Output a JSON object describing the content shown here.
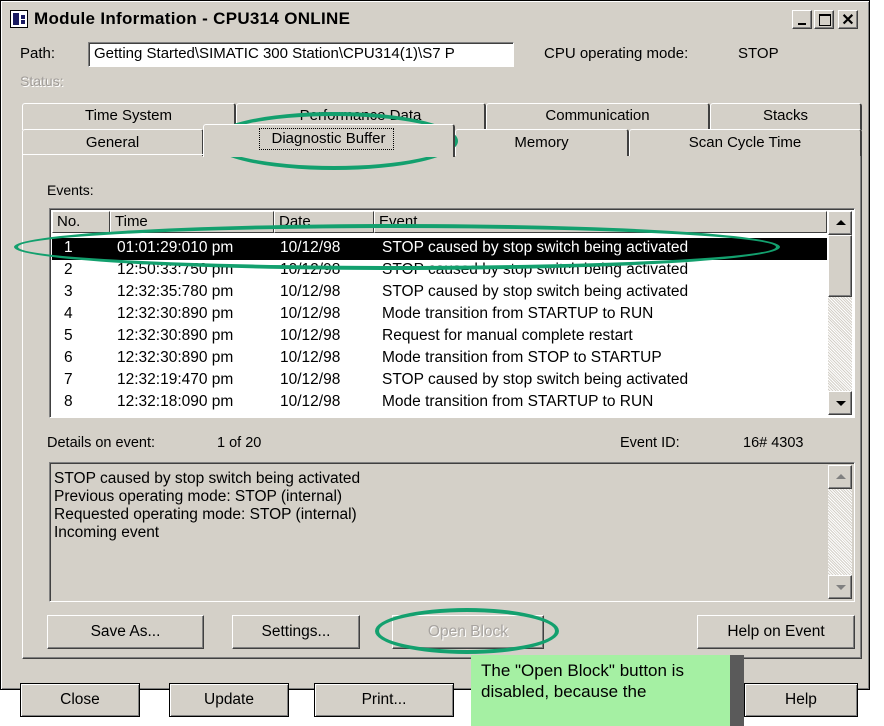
{
  "window": {
    "title": "Module Information - CPU314  ONLINE"
  },
  "path": {
    "label": "Path:",
    "value": "Getting Started\\SIMATIC 300 Station\\CPU314(1)\\S7 P"
  },
  "cpu_mode": {
    "label": "CPU operating mode:",
    "value": "STOP"
  },
  "status": {
    "label": "Status:"
  },
  "tabs_top": [
    "Time System",
    "Performance Data",
    "Communication",
    "Stacks"
  ],
  "tabs_bottom": [
    "General",
    "Diagnostic Buffer",
    "Memory",
    "Scan Cycle Time"
  ],
  "events": {
    "label": "Events:",
    "columns": [
      "No.",
      "Time",
      "Date",
      "Event"
    ],
    "rows": [
      {
        "no": "1",
        "time": "01:01:29:010 pm",
        "date": "10/12/98",
        "event": "STOP caused by stop switch being activated"
      },
      {
        "no": "2",
        "time": "12:50:33:750 pm",
        "date": "10/12/98",
        "event": "STOP caused by stop switch being activated"
      },
      {
        "no": "3",
        "time": "12:32:35:780 pm",
        "date": "10/12/98",
        "event": "STOP caused by stop switch being activated"
      },
      {
        "no": "4",
        "time": "12:32:30:890 pm",
        "date": "10/12/98",
        "event": "Mode transition from STARTUP to RUN"
      },
      {
        "no": "5",
        "time": "12:32:30:890 pm",
        "date": "10/12/98",
        "event": "Request for manual complete restart"
      },
      {
        "no": "6",
        "time": "12:32:30:890 pm",
        "date": "10/12/98",
        "event": "Mode transition from STOP to STARTUP"
      },
      {
        "no": "7",
        "time": "12:32:19:470 pm",
        "date": "10/12/98",
        "event": "STOP caused by stop switch being activated"
      },
      {
        "no": "8",
        "time": "12:32:18:090 pm",
        "date": "10/12/98",
        "event": "Mode transition from STARTUP to RUN"
      }
    ]
  },
  "details": {
    "label": "Details on event:",
    "counter": "1  of  20",
    "event_id_label": "Event ID:",
    "event_id_value": "16# 4303",
    "lines": [
      "STOP caused by stop switch being activated",
      "Previous operating mode: STOP (internal)",
      "Requested operating mode: STOP (internal)",
      "Incoming event"
    ]
  },
  "inner_buttons": {
    "save_as": "Save As...",
    "settings": "Settings...",
    "open_block": "Open Block",
    "help_on_event": "Help on Event"
  },
  "outer_buttons": {
    "close": "Close",
    "update": "Update",
    "print": "Print...",
    "help": "Help"
  },
  "annotation": {
    "text": "The \"Open Block\" button is disabled, because the"
  },
  "colors": {
    "highlight_ring": "#13a06e",
    "note_bg": "#a5f0a3",
    "selection": "#000000",
    "dialog_bg": "#d4d0c8"
  }
}
